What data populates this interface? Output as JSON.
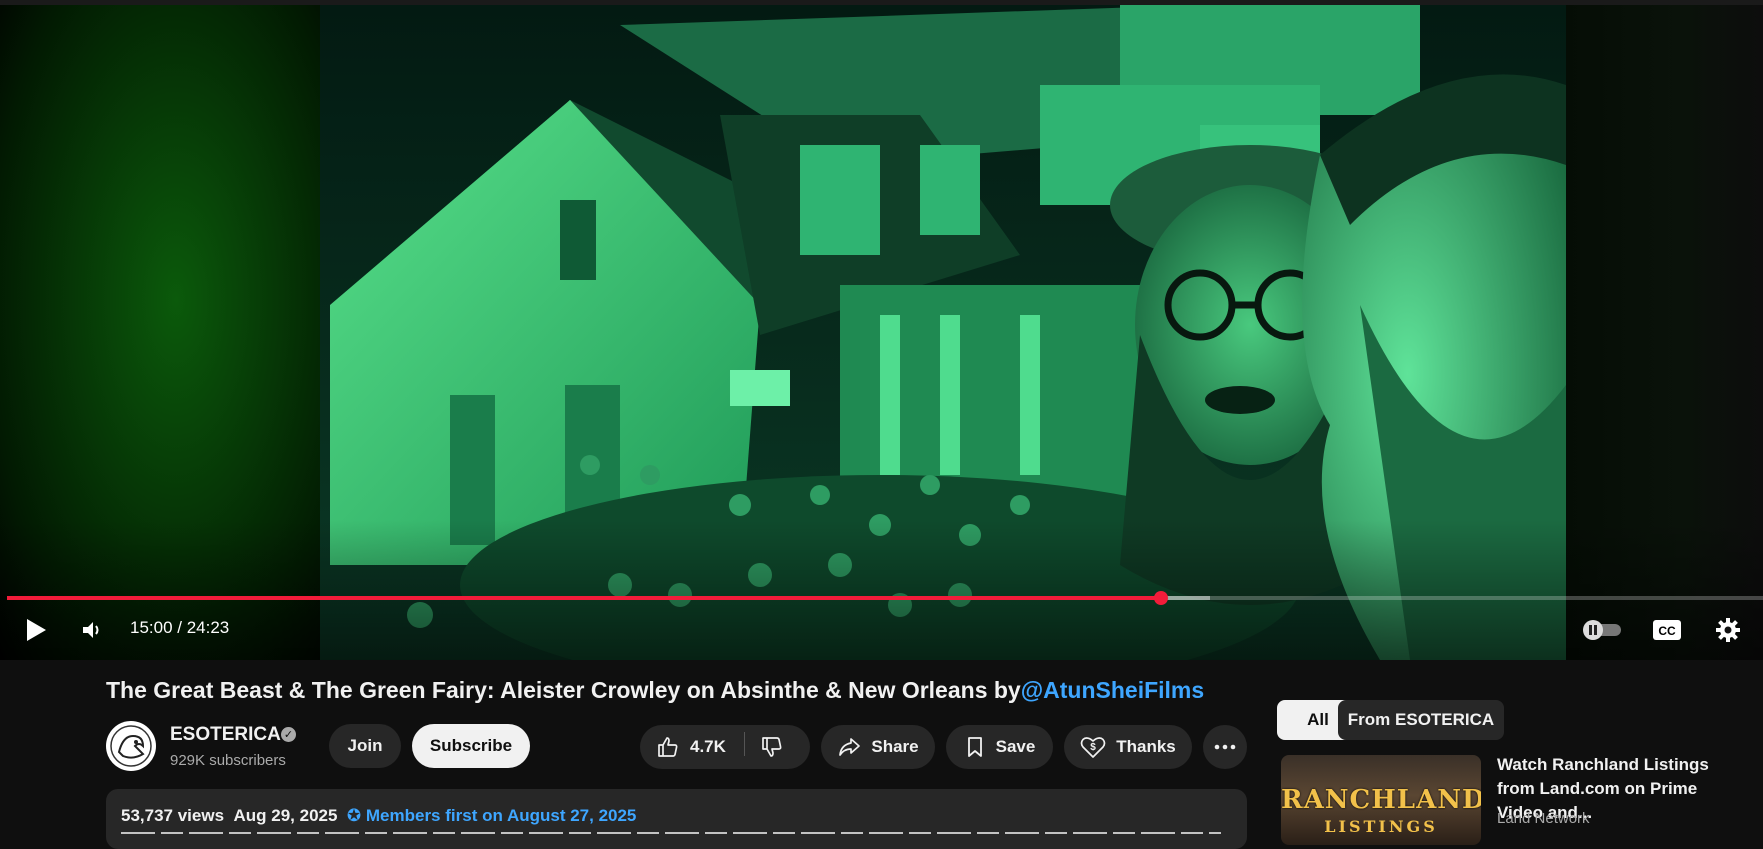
{
  "player": {
    "time_display": "15:00 / 24:23",
    "progress_fraction": 0.657,
    "loaded_fraction": 0.685,
    "colors": {
      "progress": "#f21c3a"
    }
  },
  "video": {
    "title": "The Great Beast & The Green Fairy: Aleister Crowley on Absinthe & New Orleans by",
    "title_handle": "@AtunSheiFilms"
  },
  "channel": {
    "name": "ESOTERICA",
    "subscribers": "929K subscribers",
    "join_label": "Join",
    "subscribe_label": "Subscribe"
  },
  "actions": {
    "likes": "4.7K",
    "share_label": "Share",
    "save_label": "Save",
    "thanks_label": "Thanks"
  },
  "description": {
    "views": "53,737 views",
    "date": "Aug 29, 2025",
    "members_first": "Members first on August 27, 2025"
  },
  "sidebar": {
    "chips": [
      "All",
      "From ESOTERICA"
    ],
    "recommendation": {
      "title": "Watch Ranchland Listings from Land.com on Prime Video and...",
      "channel": "Land Network",
      "thumb_text_1": "RANCHLAND",
      "thumb_text_2": "LISTINGS"
    }
  },
  "colors": {
    "accent_link": "#3ea6ff",
    "background": "#0f0f0f",
    "chip": "#272727"
  }
}
